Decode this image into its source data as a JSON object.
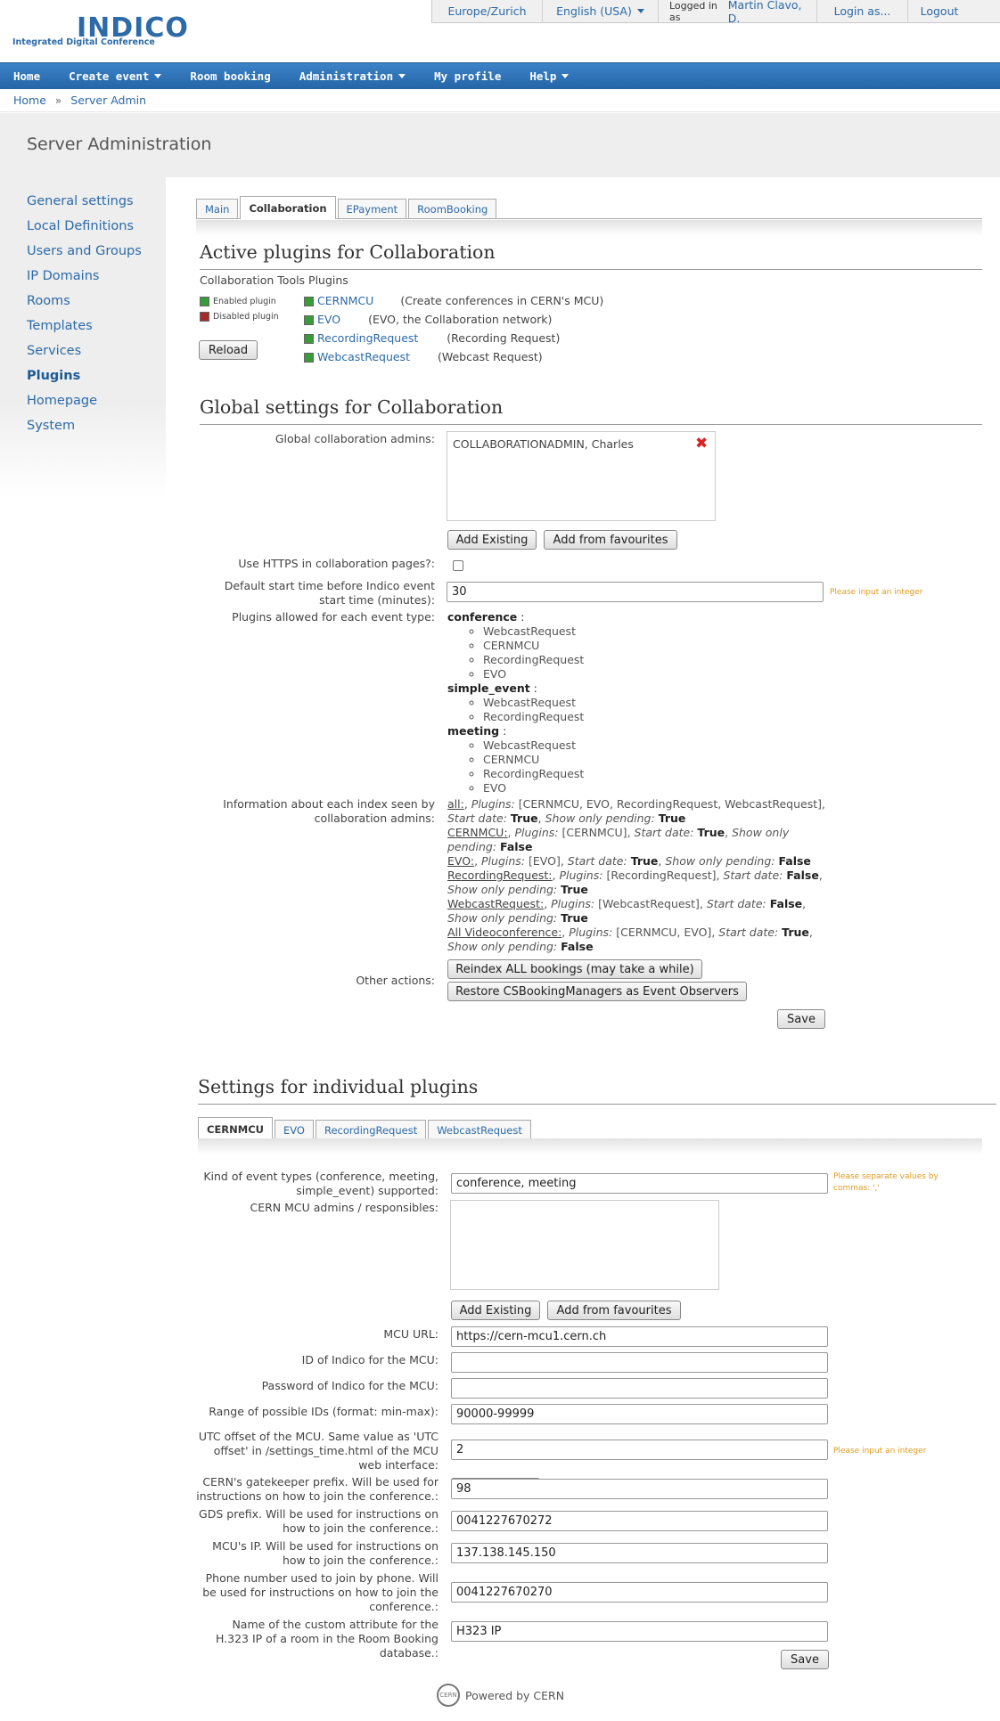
{
  "app": {
    "logo_text": "INDICO",
    "logo_sub": "Integrated Digital Conference"
  },
  "topbar": {
    "timezone": "Europe/Zurich",
    "language": "English (USA)",
    "logged_in_label": "Logged in as",
    "user": "Martin Clavo, D.",
    "login_as": "Login as...",
    "logout": "Logout"
  },
  "navbar": {
    "home": "Home",
    "create_event": "Create event",
    "room_booking": "Room booking",
    "administration": "Administration",
    "my_profile": "My profile",
    "help": "Help"
  },
  "breadcrumb": {
    "home": "Home",
    "separator": "»",
    "current": "Server Admin"
  },
  "page_title": "Server Administration",
  "sidebar": {
    "items": [
      {
        "label": "General settings"
      },
      {
        "label": "Local Definitions"
      },
      {
        "label": "Users and Groups"
      },
      {
        "label": "IP Domains"
      },
      {
        "label": "Rooms"
      },
      {
        "label": "Templates"
      },
      {
        "label": "Services"
      },
      {
        "label": "Plugins",
        "active": true
      },
      {
        "label": "Homepage"
      },
      {
        "label": "System"
      }
    ]
  },
  "plugin_tabs": [
    "Main",
    "Collaboration",
    "EPayment",
    "RoomBooking"
  ],
  "active": {
    "heading": "Active plugins for Collaboration",
    "subheading": "Collaboration Tools Plugins",
    "legend_enabled": "Enabled plugin",
    "legend_disabled": "Disabled plugin",
    "reload": "Reload",
    "plugins": [
      {
        "name": "CERNMCU",
        "desc": "(Create conferences in CERN's MCU)"
      },
      {
        "name": "EVO",
        "desc": "(EVO, the Collaboration network)"
      },
      {
        "name": "RecordingRequest",
        "desc": "(Recording Request)"
      },
      {
        "name": "WebcastRequest",
        "desc": "(Webcast Request)"
      }
    ],
    "colors": {
      "enabled": "#3a9b3a",
      "disabled": "#a52a2a"
    }
  },
  "global": {
    "heading": "Global settings for Collaboration",
    "admins_label": "Global collaboration admins:",
    "admin_entry": "COLLABORATIONADMIN, Charles",
    "add_existing": "Add Existing",
    "add_favourites": "Add from favourites",
    "https_label": "Use HTTPS in collaboration pages?:",
    "start_time_label": "Default start time before Indico event start time (minutes):",
    "start_time_value": "30",
    "integer_hint": "Please input an integer",
    "allowed_label": "Plugins allowed for each event type:",
    "event_types": [
      {
        "name": "conference",
        "plugins": [
          "WebcastRequest",
          "CERNMCU",
          "RecordingRequest",
          "EVO"
        ]
      },
      {
        "name": "simple_event",
        "plugins": [
          "WebcastRequest",
          "RecordingRequest"
        ]
      },
      {
        "name": "meeting",
        "plugins": [
          "WebcastRequest",
          "CERNMCU",
          "RecordingRequest",
          "EVO"
        ]
      }
    ],
    "index_label": "Information about each index seen by collaboration admins:",
    "indexes": [
      {
        "name": "all:",
        "plugins": "[CERNMCU, EVO, RecordingRequest, WebcastRequest]",
        "start": "True",
        "pending": "True"
      },
      {
        "name": "CERNMCU:",
        "plugins": "[CERNMCU]",
        "start": "True",
        "pending": "False"
      },
      {
        "name": "EVO:",
        "plugins": "[EVO]",
        "start": "True",
        "pending": "False"
      },
      {
        "name": "RecordingRequest:",
        "plugins": "[RecordingRequest]",
        "start": "False",
        "pending": "True"
      },
      {
        "name": "WebcastRequest:",
        "plugins": "[WebcastRequest]",
        "start": "False",
        "pending": "True"
      },
      {
        "name": "All Videoconference:",
        "plugins": "[CERNMCU, EVO]",
        "start": "True",
        "pending": "False"
      }
    ],
    "txt_plugins": "Plugins:",
    "txt_start": "Start date:",
    "txt_pending": "Show only pending:",
    "other_label": "Other actions:",
    "reindex": "Reindex ALL bookings (may take a while)",
    "restore": "Restore CSBookingManagers as Event Observers",
    "save": "Save"
  },
  "individual": {
    "heading": "Settings for individual plugins",
    "tabs": [
      "CERNMCU",
      "EVO",
      "RecordingRequest",
      "WebcastRequest"
    ],
    "kinds_label": "Kind of event types (conference, meeting, simple_event) supported:",
    "kinds_value": "conference, meeting",
    "kinds_hint": "Please separate values by commas: ','",
    "mcu_admins_label": "CERN MCU admins / responsibles:",
    "add_existing": "Add Existing",
    "add_favourites": "Add from favourites",
    "mcu_url_label": "MCU URL:",
    "mcu_url_value": "https://cern-mcu1.cern.ch",
    "indico_id_label": "ID of Indico for the MCU:",
    "indico_id_value": "",
    "password_label": "Password of Indico for the MCU:",
    "password_value": "",
    "range_label": "Range of possible IDs (format: min-max):",
    "range_value": "90000-99999",
    "utc_label": "UTC offset of the MCU. Same value as 'UTC offset' in /settings_time.html of the MCU web interface:",
    "utc_value": "2",
    "utc_hint": "Please input an integer",
    "gatekeeper_label": "CERN's gatekeeper prefix. Will be used for instructions on how to join the conference.:",
    "gatekeeper_value": "98",
    "gds_label": "GDS prefix. Will be used for instructions on how to join the conference.:",
    "gds_value": "0041227670272",
    "ip_label": "MCU's IP. Will be used for instructions on how to join the conference.:",
    "ip_value": "137.138.145.150",
    "phone_label": "Phone number used to join by phone. Will be used for instructions on how to join the conference.:",
    "phone_value": "0041227670270",
    "h323_label": "Name of the custom attribute for the H.323 IP of a room in the Room Booking database.:",
    "h323_value": "H323 IP",
    "save": "Save"
  },
  "footer": {
    "powered": "Powered by CERN",
    "badge": "CERN"
  }
}
